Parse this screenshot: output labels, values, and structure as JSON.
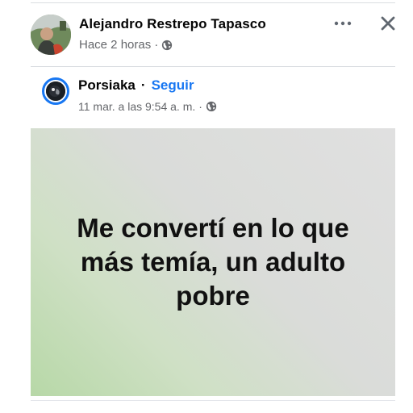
{
  "post": {
    "author": "Alejandro Restrepo Tapasco",
    "time": "Hace 2 horas",
    "separator": "·",
    "privacy_icon": "globe-icon",
    "more_icon": "more-horizontal-icon",
    "close_icon": "close-icon"
  },
  "shared_post": {
    "page_name": "Porsiaka",
    "separator": "·",
    "follow_label": "Seguir",
    "date": "11 mar. a las 9:54 a. m.",
    "date_separator": "·",
    "privacy_icon": "globe-icon",
    "text": "Me convertí en lo que más temía, un adulto pobre"
  },
  "colors": {
    "link_blue": "#1877f2",
    "secondary_text": "#65676b",
    "card_green": "#b7d8a7",
    "card_gray": "#e0e0e0"
  }
}
